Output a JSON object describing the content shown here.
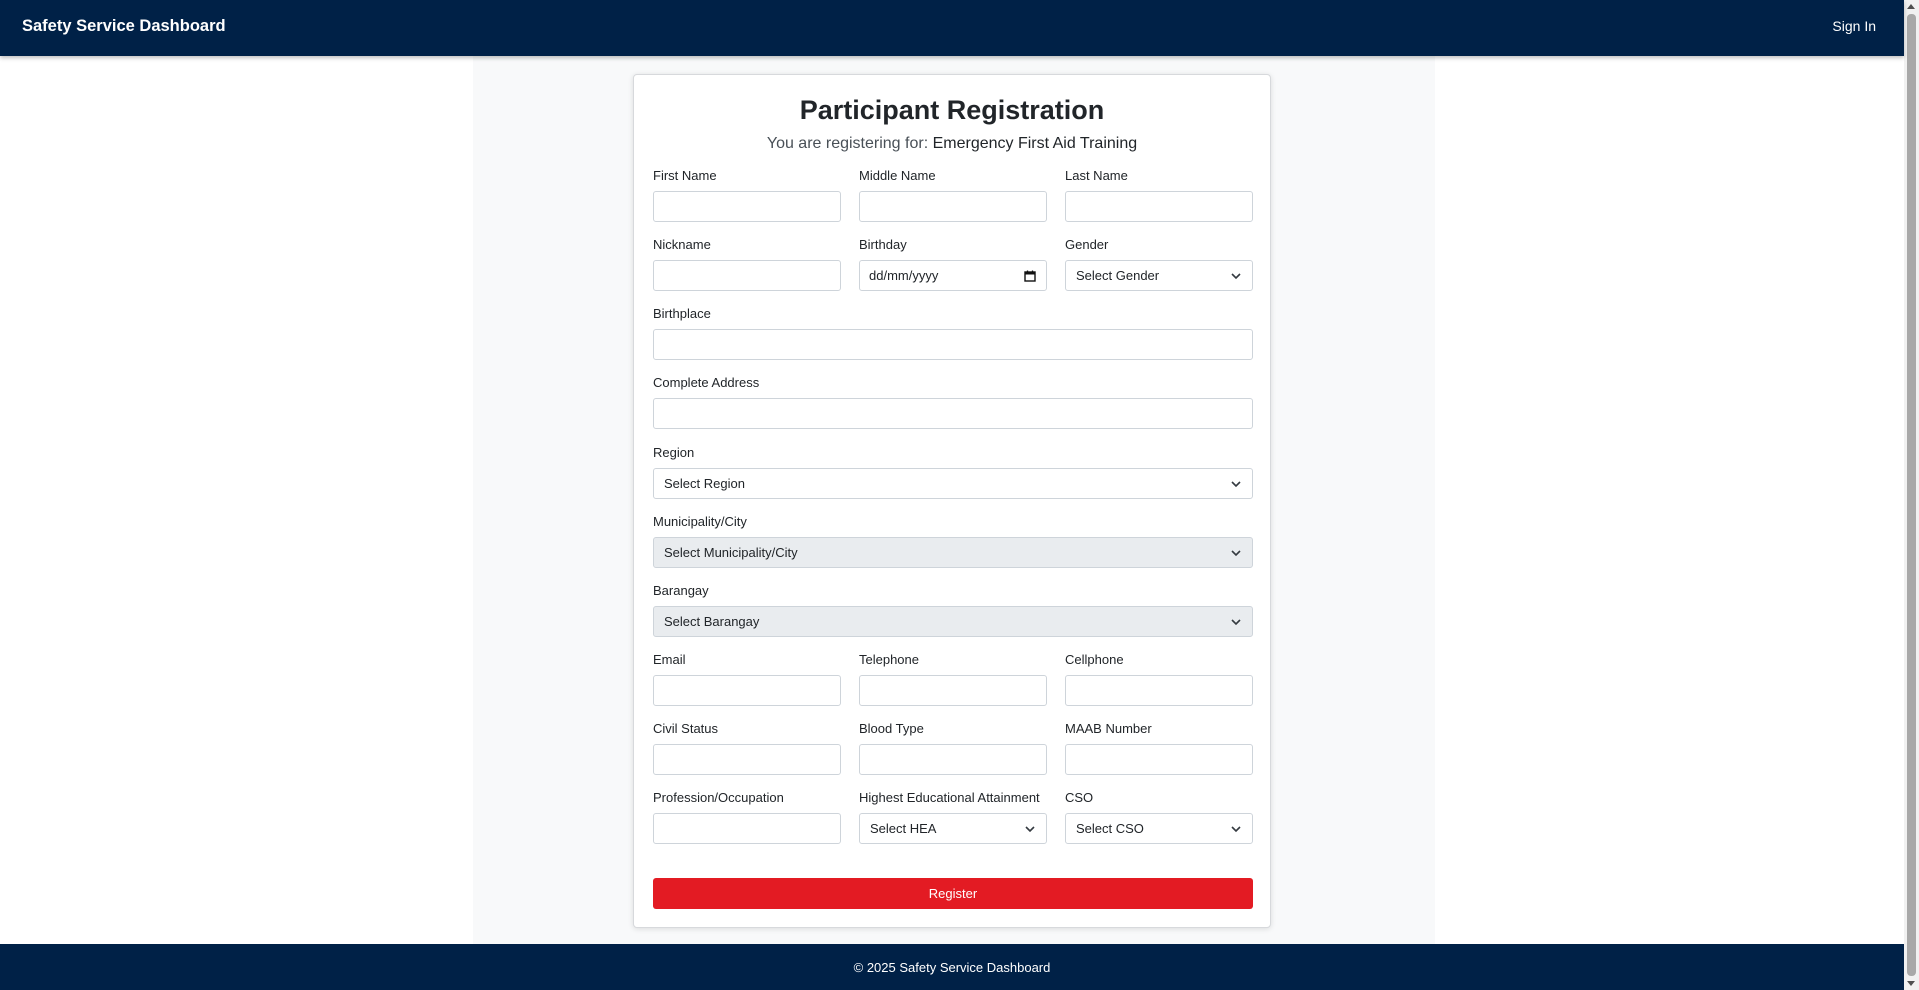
{
  "navbar": {
    "brand": "Safety Service Dashboard",
    "signin": "Sign In"
  },
  "form": {
    "title": "Participant Registration",
    "subtitle_prefix": "You are registering for: ",
    "course": "Emergency First Aid Training",
    "labels": {
      "first_name": "First Name",
      "middle_name": "Middle Name",
      "last_name": "Last Name",
      "nickname": "Nickname",
      "birthday": "Birthday",
      "gender": "Gender",
      "birthplace": "Birthplace",
      "address": "Complete Address",
      "region": "Region",
      "municipality": "Municipality/City",
      "barangay": "Barangay",
      "email": "Email",
      "telephone": "Telephone",
      "cellphone": "Cellphone",
      "civil_status": "Civil Status",
      "blood_type": "Blood Type",
      "maab": "MAAB Number",
      "profession": "Profession/Occupation",
      "hea": "Highest Educational Attainment",
      "cso": "CSO"
    },
    "values": {
      "birthday_placeholder": "dd/mm/yyyy",
      "gender": "Select Gender",
      "region": "Select Region",
      "municipality": "Select Municipality/City",
      "barangay": "Select Barangay",
      "hea": "Select HEA",
      "cso": "Select CSO"
    },
    "register_label": "Register"
  },
  "footer": {
    "text": "© 2025 Safety Service Dashboard"
  }
}
